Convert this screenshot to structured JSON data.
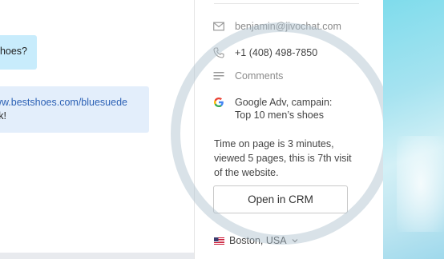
{
  "chat": {
    "bubble_1_text": "hoes?",
    "bubble_2_link": "www.bestshoes.com/bluesuede",
    "bubble_2_tail": "k!"
  },
  "contact": {
    "email": "benjamin@jivochat.com",
    "phone": "+1 (408) 498-7850",
    "comments_placeholder": "Comments",
    "source_line1": "Google Adv, campain:",
    "source_line2": "Top 10 men’s shoes",
    "visit_info": "Time on page is 3 minutes, viewed 5 pages, this is 7th visit of the website.",
    "crm_button": "Open in CRM",
    "location": "Boston, USA"
  },
  "icons": {
    "email": "envelope-icon",
    "phone": "phone-icon",
    "comments": "lines-icon",
    "source": "google-icon",
    "flag": "us-flag-icon",
    "chevron": "chevron-down-icon"
  },
  "colors": {
    "bubble_1": "#c8ecfc",
    "bubble_2": "#e3eefb",
    "link": "#2c61b5",
    "accent_side": "#7fdcec"
  }
}
